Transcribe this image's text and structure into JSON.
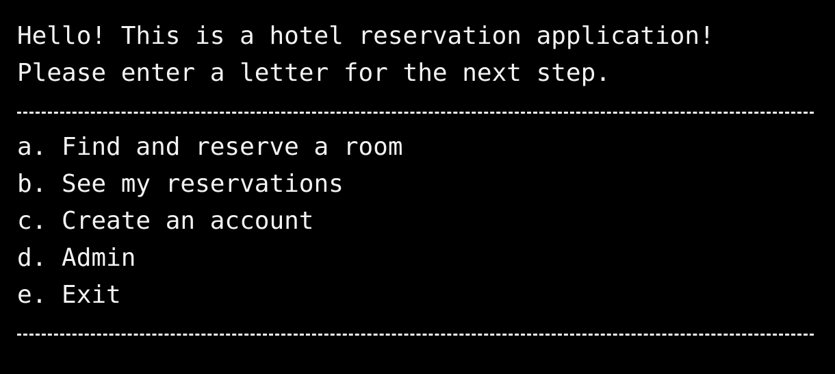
{
  "terminal": {
    "greeting": "Hello! This is a hotel reservation application!",
    "prompt": "Please enter a letter for the next step.",
    "menu": [
      {
        "text": "a. Find and reserve a room"
      },
      {
        "text": "b. See my reservations"
      },
      {
        "text": "c. Create an account"
      },
      {
        "text": "d. Admin"
      },
      {
        "text": "e. Exit"
      }
    ]
  },
  "colors": {
    "background": "#000000",
    "foreground": "#f2f2f2"
  }
}
